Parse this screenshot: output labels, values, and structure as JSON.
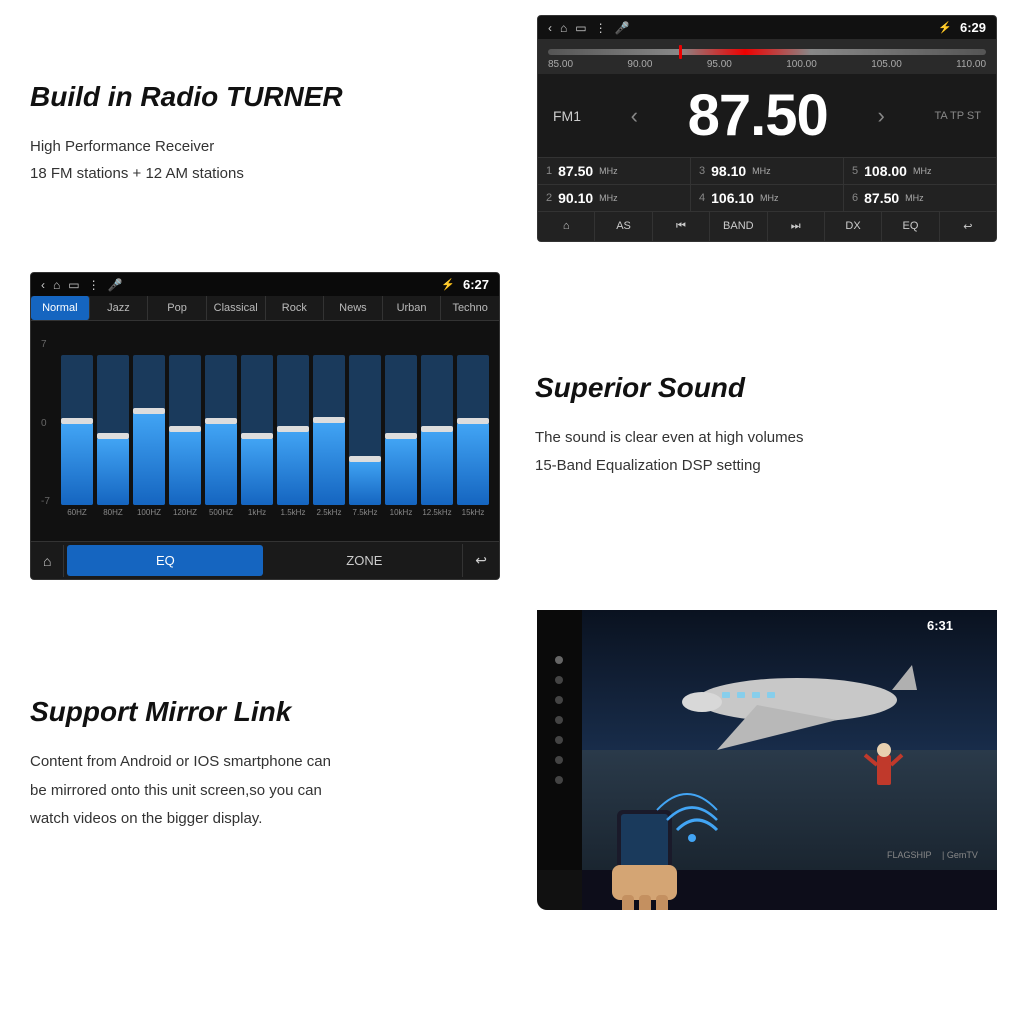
{
  "page": {
    "background": "#ffffff"
  },
  "radio_section": {
    "title": "Build in Radio TURNER",
    "feature1": "High Performance Receiver",
    "feature2": "18 FM stations + 12 AM stations",
    "ui": {
      "status_time": "6:29",
      "band": "FM1",
      "frequency": "87.50",
      "ta_labels": "TA TP ST",
      "freq_min": "85.00",
      "freq_marks": [
        "90.00",
        "95.00",
        "100.00",
        "105.00",
        "110.00"
      ],
      "presets": [
        {
          "num": "1",
          "freq": "87.50",
          "unit": "MHz"
        },
        {
          "num": "3",
          "freq": "98.10",
          "unit": "MHz"
        },
        {
          "num": "5",
          "freq": "108.00",
          "unit": "MHz"
        },
        {
          "num": "2",
          "freq": "90.10",
          "unit": "MHz"
        },
        {
          "num": "4",
          "freq": "106.10",
          "unit": "MHz"
        },
        {
          "num": "6",
          "freq": "87.50",
          "unit": "MHz"
        }
      ],
      "controls": [
        "🏠",
        "AS",
        "⏮",
        "BAND",
        "⏭",
        "DX",
        "EQ",
        "↩"
      ]
    }
  },
  "eq_section": {
    "title": "Superior Sound",
    "feature1": "The sound is clear even at high volumes",
    "feature2": "15-Band Equalization DSP setting",
    "ui": {
      "status_time": "6:27",
      "presets": [
        "Normal",
        "Jazz",
        "Pop",
        "Classical",
        "Rock",
        "News",
        "Urban",
        "Techno"
      ],
      "active_preset": "Normal",
      "scale": [
        "7",
        "0",
        "-7"
      ],
      "bands": [
        {
          "label": "60HZ",
          "fill_pct": 55,
          "thumb_pct": 45
        },
        {
          "label": "80HZ",
          "fill_pct": 45,
          "thumb_pct": 55
        },
        {
          "label": "100HZ",
          "fill_pct": 60,
          "thumb_pct": 40
        },
        {
          "label": "120HZ",
          "fill_pct": 50,
          "thumb_pct": 50
        },
        {
          "label": "500HZ",
          "fill_pct": 55,
          "thumb_pct": 45
        },
        {
          "label": "1kHz",
          "fill_pct": 45,
          "thumb_pct": 55
        },
        {
          "label": "1.5kHz",
          "fill_pct": 50,
          "thumb_pct": 50
        },
        {
          "label": "2.5kHz",
          "fill_pct": 55,
          "thumb_pct": 45
        },
        {
          "label": "7.5kHz",
          "fill_pct": 30,
          "thumb_pct": 70
        },
        {
          "label": "10kHz",
          "fill_pct": 45,
          "thumb_pct": 55
        },
        {
          "label": "12.5kHz",
          "fill_pct": 50,
          "thumb_pct": 50
        },
        {
          "label": "15kHz",
          "fill_pct": 55,
          "thumb_pct": 45
        }
      ],
      "controls": {
        "eq_label": "EQ",
        "zone_label": "ZONE"
      }
    }
  },
  "mirror_section": {
    "title": "Support Mirror Link",
    "description_line1": "Content from Android or IOS smartphone can",
    "description_line2": "be mirrored onto this unit screen,so you can",
    "description_line3": "watch videos on the  bigger display.",
    "ui": {
      "screen_time": "6:31",
      "brand1": "FLAGSHIP",
      "brand2": "GemTV"
    }
  }
}
